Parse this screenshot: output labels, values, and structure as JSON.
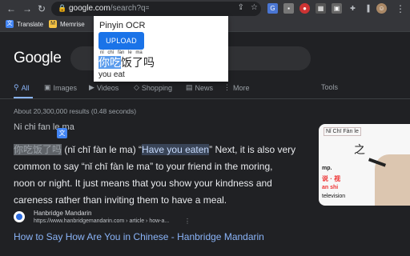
{
  "browser": {
    "url_host": "google.com",
    "url_rest": "/search?q=ni+chi+fan+le+ma&rlz=1...",
    "bookmarks": [
      {
        "label": "Translate"
      },
      {
        "label": "Memrise"
      }
    ]
  },
  "google": {
    "logo": "Google",
    "tabs": [
      {
        "label": "All"
      },
      {
        "label": "Images"
      },
      {
        "label": "Videos"
      },
      {
        "label": "Shopping"
      },
      {
        "label": "News"
      },
      {
        "label": "More"
      },
      {
        "label": "Tools"
      }
    ],
    "result_stats": "About 20,300,000 results (0.48 seconds)",
    "answer_title": "Ni chi fan le ma",
    "answer": {
      "hanzi": "你吃饭了吗",
      "pinyin": " (nǐ chī fàn le ma) “",
      "quote": "Have you eaten",
      "line1_rest": "” Next, it is also very",
      "line2": "common to say “nǐ chī fàn le ma” to your friend in the moring,",
      "line3": "noon or night. It just means that you show your kindness and",
      "line4": "careness rather than inviting them to have a meal."
    },
    "thumbnail": {
      "top_text": "Nǐ Chī Fàn le",
      "text1": "mp.",
      "text2": "an shi",
      "text3": "television"
    },
    "result": {
      "site_name": "Hanbridge Mandarin",
      "site_url": "https://www.hanbridgemandarin.com › article › how-a...",
      "title": "How to Say How Are You in Chinese - Hanbridge Mandarin"
    }
  },
  "popup": {
    "title": "Pinyin OCR",
    "upload_label": "UPLOAD",
    "pinyin": "nǐ chī fàn le ma",
    "chinese_selected": "你吃",
    "chinese_rest": "饭了吗",
    "translation": "you eat"
  }
}
